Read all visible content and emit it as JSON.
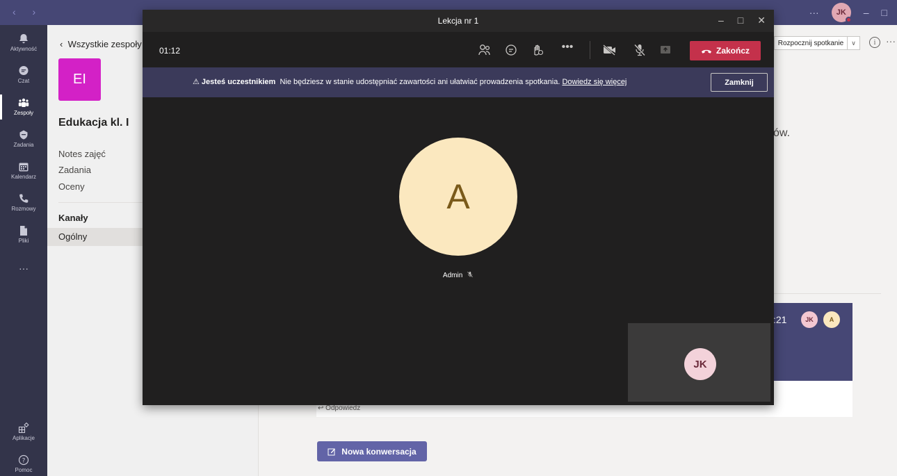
{
  "topbar": {
    "user_initials": "JK",
    "more": "···"
  },
  "rail": {
    "items": [
      {
        "label": "Aktywność",
        "icon": "bell-icon"
      },
      {
        "label": "Czat",
        "icon": "chat-icon"
      },
      {
        "label": "Zespoły",
        "icon": "teams-icon"
      },
      {
        "label": "Zadania",
        "icon": "assignments-icon"
      },
      {
        "label": "Kalendarz",
        "icon": "calendar-icon"
      },
      {
        "label": "Rozmowy",
        "icon": "phone-icon"
      },
      {
        "label": "Pliki",
        "icon": "file-icon"
      }
    ],
    "more": "···",
    "apps_label": "Aplikacje",
    "help_label": "Pomoc"
  },
  "team_panel": {
    "back": "Wszystkie zespoły",
    "tile_initials": "EI",
    "team_name": "Edukacja kl. I",
    "links": [
      "Notes zajęć",
      "Zadania",
      "Oceny"
    ],
    "channels_header": "Kanały",
    "channels": [
      "Ogólny"
    ]
  },
  "main": {
    "start_meeting": "Rozpocznij spotkanie",
    "partial_text": "ów.",
    "card_time": ":21",
    "card_avatars": [
      "JK",
      "A"
    ],
    "reply": "Odpowiedz",
    "new_conversation": "Nowa konwersacja"
  },
  "meeting": {
    "title": "Lekcja nr 1",
    "timer": "01:12",
    "end_button": "Zakończ",
    "banner": {
      "bold": "Jesteś uczestnikiem",
      "text": "Nie będziesz w stanie udostępniać zawartości ani ułatwiać prowadzenia spotkania.",
      "link": "Dowiedz się więcej",
      "close": "Zamknij"
    },
    "main_participant": {
      "initial": "A",
      "name": "Admin"
    },
    "self_initials": "JK"
  },
  "colors": {
    "rail": "#33344a",
    "topbar": "#464775",
    "accent": "#6264a7",
    "end_call": "#c4314b",
    "team_tile": "#d321c6",
    "meeting_bg": "#201f1f",
    "banner": "#3b3a5a"
  }
}
